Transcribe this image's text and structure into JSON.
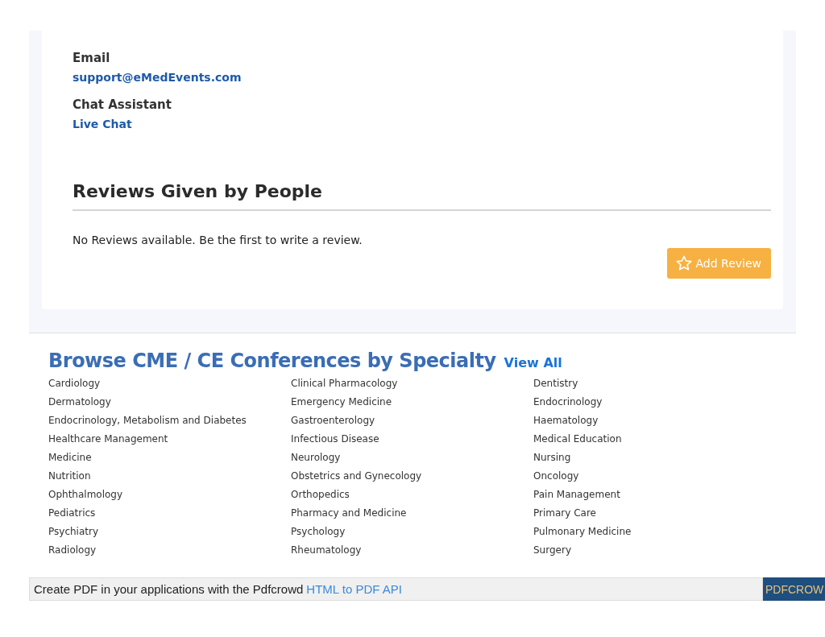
{
  "contact": [
    {
      "label": "Email",
      "value": "support@eMedEvents.com"
    },
    {
      "label": "Chat Assistant",
      "value": "Live Chat"
    }
  ],
  "reviews": {
    "title": "Reviews Given by People",
    "empty_message": "No Reviews available. Be the first to write a review.",
    "button": "Add Review"
  },
  "browse": {
    "title": "Browse CME / CE Conferences by Specialty",
    "view_all": "View All",
    "specialties": [
      "Cardiology",
      "Clinical Pharmacology",
      "Dentistry",
      "Dermatology",
      "Emergency Medicine",
      "Endocrinology",
      "Endocrinology, Metabolism and Diabetes",
      "Gastroenterology",
      "Haematology",
      "Healthcare Management",
      "Infectious Disease",
      "Medical Education",
      "Medicine",
      "Neurology",
      "Nursing",
      "Nutrition",
      "Obstetrics and Gynecology",
      "Oncology",
      "Ophthalmology",
      "Orthopedics",
      "Pain Management",
      "Pediatrics",
      "Pharmacy and Medicine",
      "Primary Care",
      "Psychiatry",
      "Psychology",
      "Pulmonary Medicine",
      "Radiology",
      "Rheumatology",
      "Surgery"
    ]
  },
  "pdf_banner": {
    "text": "Create PDF in your applications with the Pdfcrowd",
    "link": "HTML to PDF API",
    "brand": "PDFCROW"
  }
}
